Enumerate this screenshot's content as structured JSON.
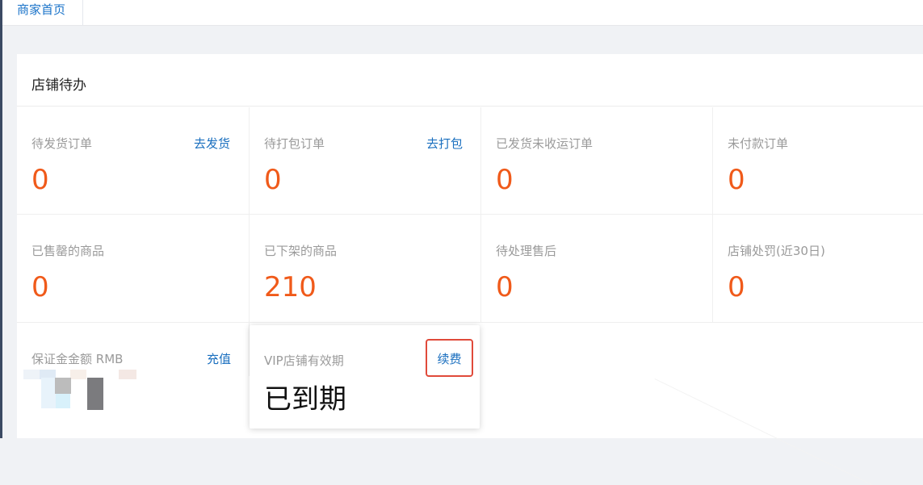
{
  "tabs": [
    {
      "label": "商家首页",
      "active": true
    }
  ],
  "card": {
    "title": "店铺待办"
  },
  "stats": [
    {
      "label": "待发货订单",
      "value": "0",
      "action": "去发货"
    },
    {
      "label": "待打包订单",
      "value": "0",
      "action": "去打包"
    },
    {
      "label": "已发货未收运订单",
      "value": "0",
      "action": ""
    },
    {
      "label": "未付款订单",
      "value": "0",
      "action": ""
    },
    {
      "label": "已售罄的商品",
      "value": "0",
      "action": ""
    },
    {
      "label": "已下架的商品",
      "value": "210",
      "action": ""
    },
    {
      "label": "待处理售后",
      "value": "0",
      "action": ""
    },
    {
      "label": "店铺处罚(近30日)",
      "value": "0",
      "action": ""
    }
  ],
  "deposit": {
    "label": "保证金金额 RMB",
    "action": "充值"
  },
  "vip": {
    "label": "VIP店铺有效期",
    "value": "已到期",
    "action": "续费"
  },
  "colors": {
    "accent": "#1a6fbf",
    "value_orange": "#f05a1a",
    "highlight_red": "#e04a3a"
  }
}
